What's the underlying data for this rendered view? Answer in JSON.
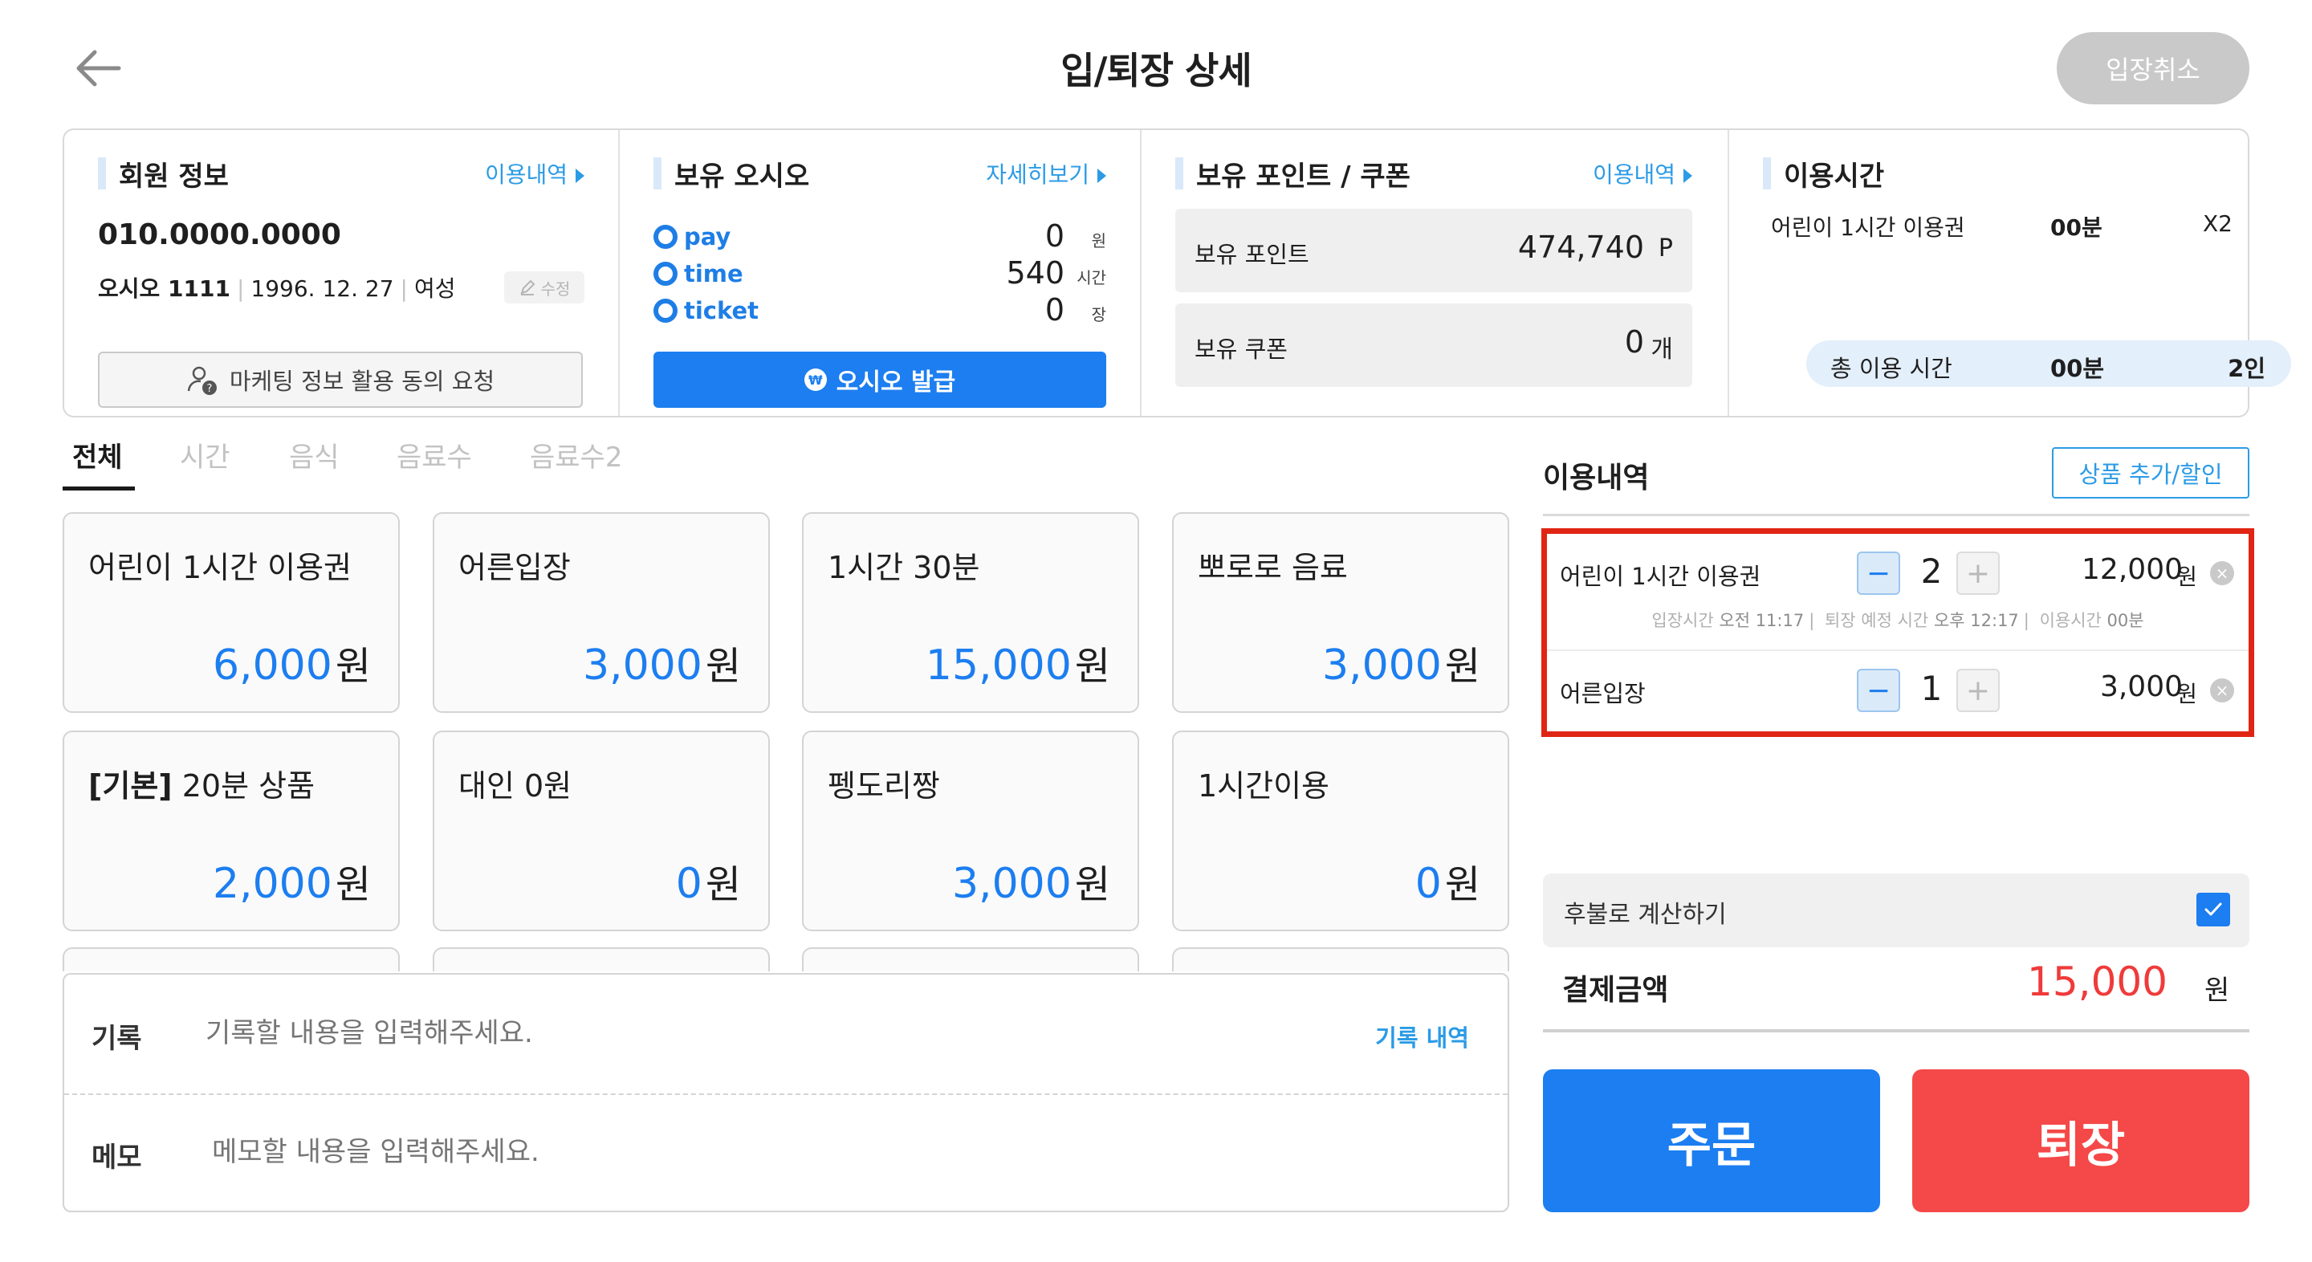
{
  "header": {
    "title": "입/퇴장 상세",
    "cancel_entry_label": "입장취소"
  },
  "member": {
    "section_title": "회원 정보",
    "link_label": "이용내역",
    "phone": "010.0000.0000",
    "name": "오시오 1111",
    "birth": "1996. 12. 27",
    "gender": "여성",
    "edit_label": "수정",
    "marketing_label": "마케팅 정보 활용 동의 요청"
  },
  "balance": {
    "section_title": "보유 오시오",
    "link_label": "자세히보기",
    "rows": [
      {
        "name": "pay",
        "value": "0",
        "unit": "원"
      },
      {
        "name": "time",
        "value": "540",
        "unit": "시간"
      },
      {
        "name": "ticket",
        "value": "0",
        "unit": "장"
      }
    ],
    "issue_label": "오시오 발급",
    "won_symbol": "₩"
  },
  "points": {
    "section_title": "보유 포인트 / 쿠폰",
    "link_label": "이용내역",
    "point_label": "보유 포인트",
    "point_value": "474,740",
    "point_unit": "P",
    "coupon_label": "보유 쿠폰",
    "coupon_value": "0",
    "coupon_unit": "개"
  },
  "usage_time": {
    "section_title": "이용시간",
    "item_name": "어린이 1시간 이용권",
    "item_time": "00분",
    "item_count": "X2",
    "total_label": "총 이용 시간",
    "total_time": "00분",
    "total_people": "2인"
  },
  "tabs": [
    {
      "label": "전체",
      "active": true
    },
    {
      "label": "시간",
      "active": false
    },
    {
      "label": "음식",
      "active": false
    },
    {
      "label": "음료수",
      "active": false
    },
    {
      "label": "음료수2",
      "active": false
    }
  ],
  "products": [
    {
      "prefix": "",
      "name": "어린이 1시간 이용권",
      "price": "6,000",
      "unit": "원"
    },
    {
      "prefix": "",
      "name": "어른입장",
      "price": "3,000",
      "unit": "원"
    },
    {
      "prefix": "",
      "name": "1시간 30분",
      "price": "15,000",
      "unit": "원"
    },
    {
      "prefix": "",
      "name": "뽀로로 음료",
      "price": "3,000",
      "unit": "원"
    },
    {
      "prefix": "[기본]",
      "name": " 20분 상품",
      "price": "2,000",
      "unit": "원"
    },
    {
      "prefix": "",
      "name": "대인 0원",
      "price": "0",
      "unit": "원"
    },
    {
      "prefix": "",
      "name": "펭도리짱",
      "price": "3,000",
      "unit": "원"
    },
    {
      "prefix": "",
      "name": "1시간이용",
      "price": "0",
      "unit": "원"
    }
  ],
  "record": {
    "record_label": "기록",
    "record_placeholder": "기록할 내용을 입력해주세요.",
    "record_link": "기록 내역",
    "memo_label": "메모",
    "memo_placeholder": "메모할 내용을 입력해주세요."
  },
  "usage_list": {
    "title": "이용내역",
    "add_label": "상품 추가/할인",
    "items": [
      {
        "name": "어린이 1시간 이용권",
        "qty": "2",
        "price": "12,000",
        "unit": "원",
        "entry_label": "입장시간",
        "entry_time": "오전 11:17",
        "exit_label": "퇴장 예정 시간",
        "exit_time": "오후 12:17",
        "use_label": "이용시간",
        "use_time": "00분"
      },
      {
        "name": "어른입장",
        "qty": "1",
        "price": "3,000",
        "unit": "원"
      }
    ],
    "minus_symbol": "−",
    "plus_symbol": "+"
  },
  "payment": {
    "deferred_label": "후불로 계산하기",
    "deferred_checked": true,
    "amount_label": "결제금액",
    "amount": "15,000",
    "amount_unit": "원",
    "order_label": "주문",
    "exit_label": "퇴장"
  },
  "colors": {
    "accent": "#1c7ef0",
    "link": "#2b9be6",
    "danger": "#f54848",
    "highlight_border": "#e02514"
  }
}
